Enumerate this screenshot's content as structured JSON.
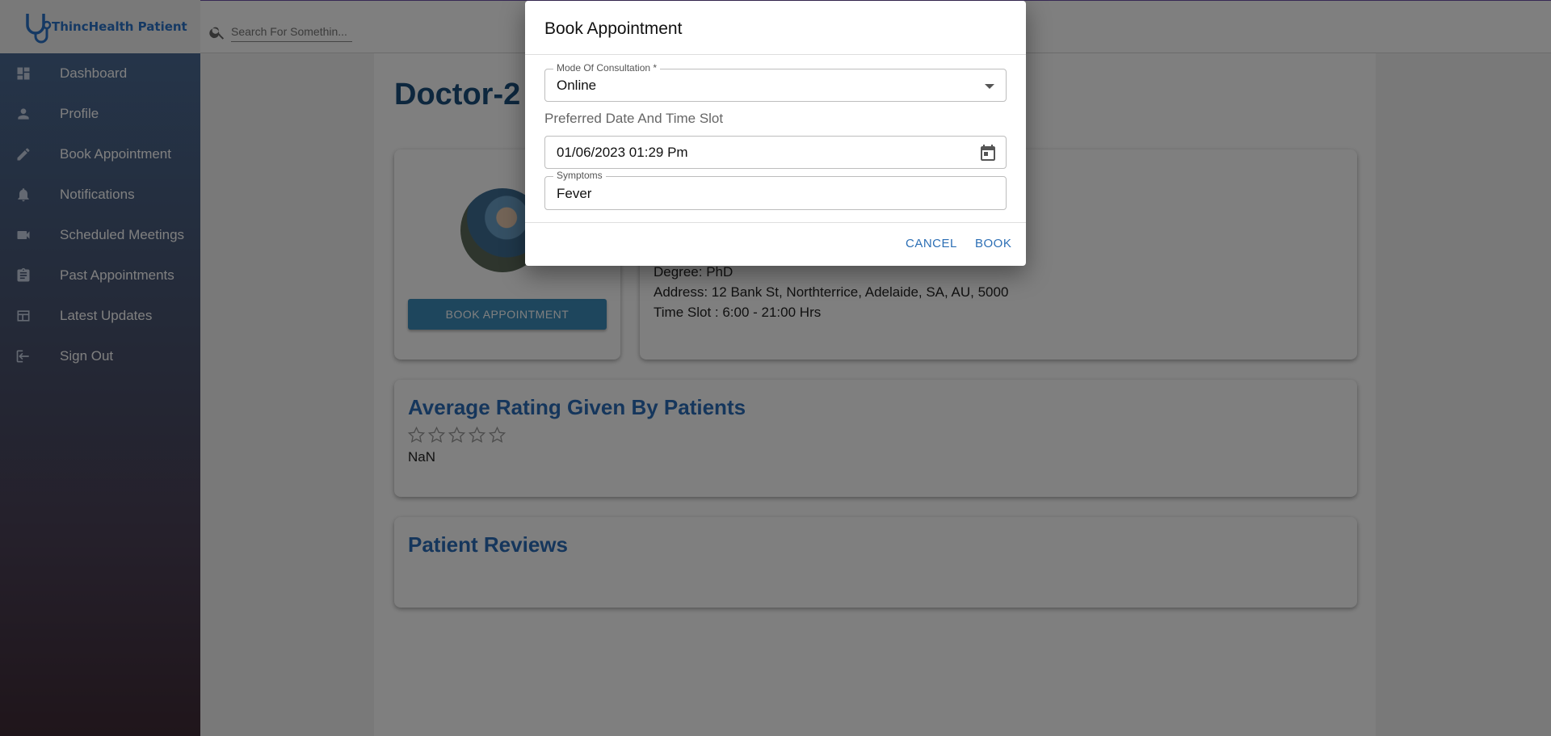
{
  "app": {
    "name": "ThincHealth Patient"
  },
  "search": {
    "placeholder": "Search For Somethin..."
  },
  "sidebar": {
    "items": [
      {
        "label": "Dashboard",
        "icon": "dashboard-icon"
      },
      {
        "label": "Profile",
        "icon": "person-icon"
      },
      {
        "label": "Book Appointment",
        "icon": "pencil-icon"
      },
      {
        "label": "Notifications",
        "icon": "bell-icon"
      },
      {
        "label": "Scheduled Meetings",
        "icon": "video-camera-icon"
      },
      {
        "label": "Past Appointments",
        "icon": "clipboard-icon"
      },
      {
        "label": "Latest Updates",
        "icon": "table-icon"
      },
      {
        "label": "Sign Out",
        "icon": "logout-icon"
      }
    ]
  },
  "doctor": {
    "name": "Doctor-2",
    "book_button": "BOOK APPOINTMENT",
    "degree": "Degree: PhD",
    "address": "Address: 12 Bank St, Northterrice, Adelaide, SA, AU, 5000",
    "time_slot": "Time Slot : 6:00 - 21:00 Hrs"
  },
  "rating": {
    "heading": "Average Rating Given By Patients",
    "value": "NaN",
    "stars_filled": 0,
    "stars_total": 5
  },
  "reviews": {
    "heading": "Patient Reviews"
  },
  "dialog": {
    "title": "Book Appointment",
    "mode_label": "Mode Of Consultation *",
    "mode_value": "Online",
    "datetime_section": "Preferred Date And Time Slot",
    "datetime_value": "01/06/2023 01:29 Pm",
    "symptoms_label": "Symptoms",
    "symptoms_value": "Fever",
    "cancel": "CANCEL",
    "book": "BOOK"
  },
  "colors": {
    "accent": "#2c6fb5",
    "heading_blue": "#2a6cb8",
    "doctor_title": "#1b4f7d",
    "book_button": "#3c8dbb"
  }
}
